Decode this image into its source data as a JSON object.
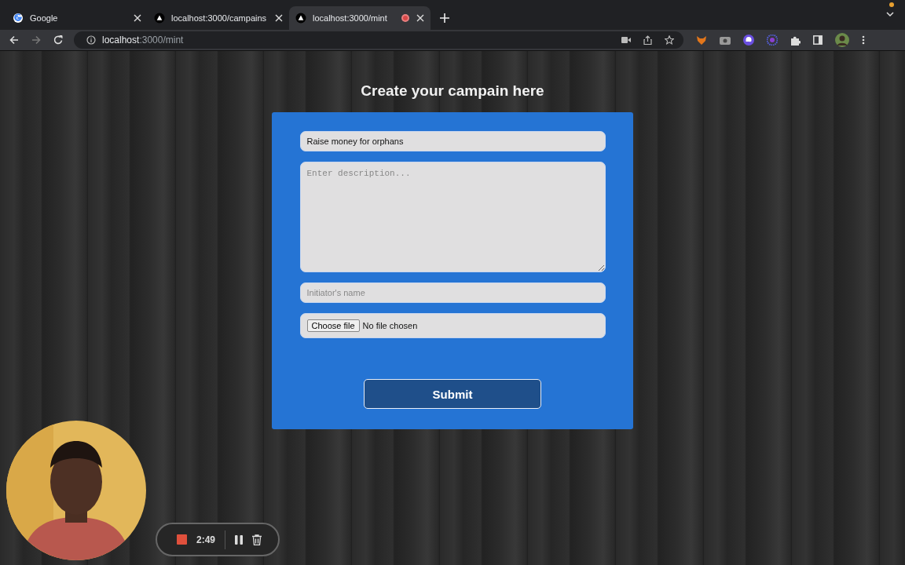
{
  "tabs": [
    {
      "title": "Google",
      "kind": "google",
      "selected": false,
      "recording": false
    },
    {
      "title": "localhost:3000/campains",
      "kind": "triangle",
      "selected": false,
      "recording": false
    },
    {
      "title": "localhost:3000/mint",
      "kind": "triangle",
      "selected": true,
      "recording": true
    }
  ],
  "address_bar": {
    "host": "localhost",
    "path": ":3000/mint"
  },
  "page": {
    "heading": "Create your campain here",
    "form": {
      "title_field": {
        "value": "Raise money for orphans"
      },
      "description_field": {
        "placeholder": "Enter description..."
      },
      "name_field": {
        "placeholder": "Initiator's name"
      },
      "file_field": {
        "button": "Choose file",
        "status": "No file chosen"
      },
      "submit": "Submit"
    }
  },
  "recorder": {
    "time": "2:49"
  }
}
